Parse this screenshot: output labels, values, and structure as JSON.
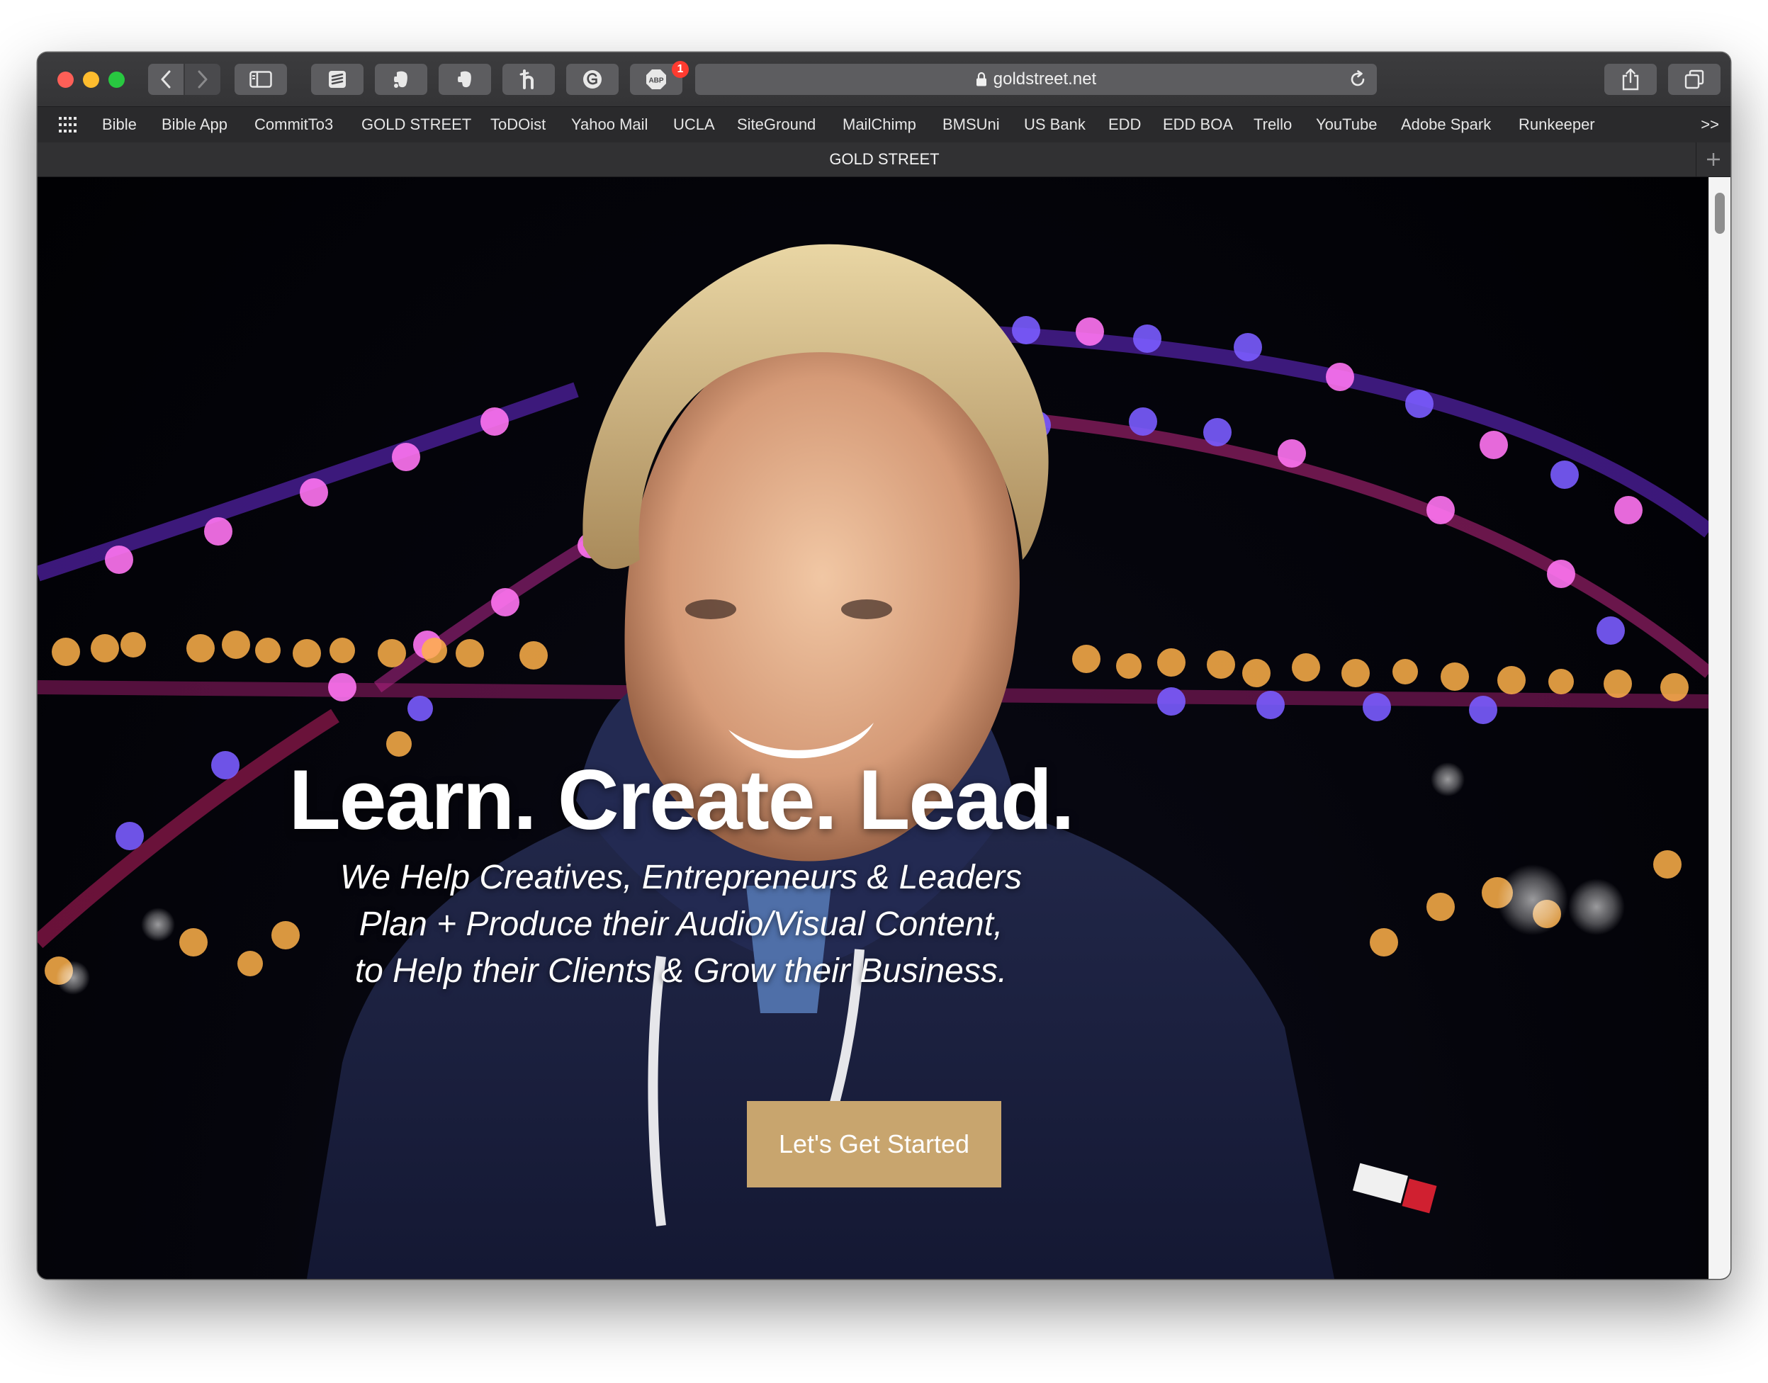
{
  "browser": {
    "url": "goldstreet.net",
    "tab_title": "GOLD STREET",
    "extension_badge_count": "1",
    "bookmarks_overflow": ">>",
    "bookmarks": [
      "Bible",
      "Bible App",
      "CommitTo3",
      "GOLD STREET",
      "ToDOist",
      "Yahoo Mail",
      "UCLA",
      "SiteGround",
      "MailChimp",
      "BMSUni",
      "US Bank",
      "EDD",
      "EDD BOA",
      "Trello",
      "YouTube",
      "Adobe Spark",
      "Runkeeper"
    ]
  },
  "hero": {
    "title": "Learn. Create. Lead.",
    "subtitle_lines": [
      "We Help Creatives, Entrepreneurs & Leaders",
      "Plan + Produce their Audio/Visual Content,",
      "to Help their Clients & Grow their Business."
    ],
    "cta_label": "Let's Get Started"
  },
  "colors": {
    "cta_background": "#c8a56e",
    "toolbar": "#3a3a3c",
    "badge": "#ff3b30",
    "bokeh_pink": "#ff5cf0",
    "bokeh_blue": "#6b4dff",
    "bokeh_amber": "#ffb14a"
  },
  "icons": [
    "back-arrow-icon",
    "forward-arrow-icon",
    "sidebar-icon",
    "reading-list-icon",
    "evernote-icon",
    "grammarly-icon",
    "adblock-icon",
    "lock-icon",
    "reload-icon",
    "share-icon",
    "tabs-overview-icon",
    "apps-grid-icon",
    "new-tab-plus-icon"
  ]
}
